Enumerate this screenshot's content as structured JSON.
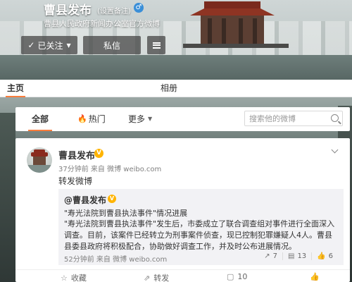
{
  "profile": {
    "name": "曹县发布",
    "note": "(设置备注)",
    "gender_icon": "male-icon",
    "description": "曹县人民政府新闻办公室官方微博",
    "followed_label": "已关注",
    "message_label": "私信"
  },
  "tabs": {
    "home": "主页",
    "album": "相册"
  },
  "filter": {
    "all": "全部",
    "hot": "热门",
    "more": "更多",
    "search_placeholder": "搜索他的微博"
  },
  "post": {
    "author": "曹县发布",
    "meta": "37分钟前 来自 微博 weibo.com",
    "text": "转发微博",
    "repost": {
      "author": "@曹县发布",
      "title": "\"寿光法院到曹县执法事件\"情况进展",
      "body": "\"寿光法院到曹县执法事件\"发生后，市委成立了联合调查组对事件进行全面深入调查。目前，该案件已经转立为刑事案件侦查，现已控制犯罪嫌疑人4人。曹县县委县政府将积极配合，协助做好调查工作，并及时公布进展情况。",
      "footer": "52分钟前 来自 微博 weibo.com",
      "forwards": "7",
      "comments": "13",
      "likes": "6"
    }
  },
  "actions": {
    "favorite": "收藏",
    "forward": "转发",
    "comment": "10",
    "like": ""
  },
  "colors": {
    "accent": "#fa7d3c",
    "vip": "#ffb400"
  }
}
